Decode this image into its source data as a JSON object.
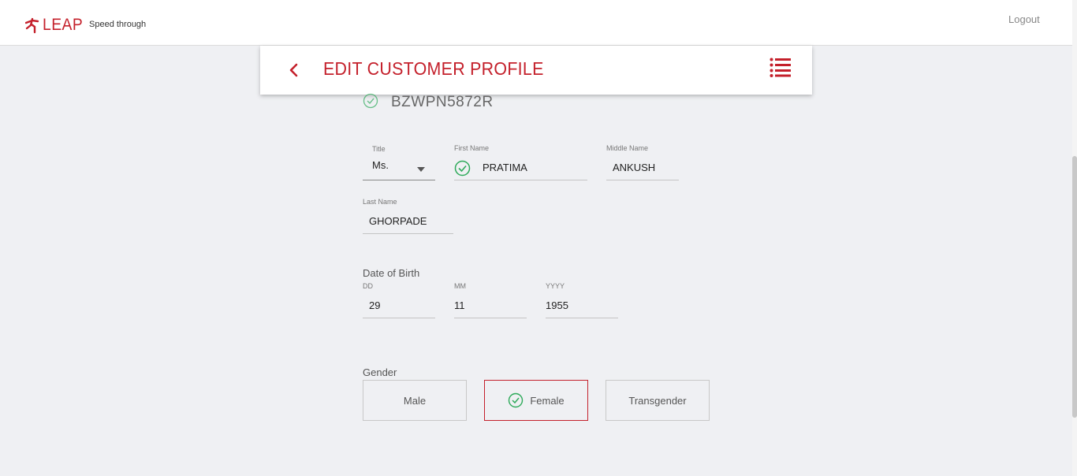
{
  "header": {
    "logo_text": "LEAP",
    "tagline": "Speed through",
    "logout_label": "Logout"
  },
  "page": {
    "title": "EDIT CUSTOMER PROFILE",
    "pan": "BZWPN5872R"
  },
  "name_fields": {
    "title": {
      "label": "Title",
      "value": "Ms."
    },
    "first_name": {
      "label": "First Name",
      "value": "PRATIMA"
    },
    "middle_name": {
      "label": "Middle Name",
      "value": "ANKUSH"
    },
    "last_name": {
      "label": "Last Name",
      "value": "GHORPADE"
    }
  },
  "dob": {
    "label": "Date of Birth",
    "day": {
      "label": "DD",
      "value": "29"
    },
    "month": {
      "label": "MM",
      "value": "11"
    },
    "year": {
      "label": "YYYY",
      "value": "1955"
    }
  },
  "gender": {
    "label": "Gender",
    "options": [
      "Male",
      "Female",
      "Transgender"
    ],
    "selected": "Female"
  },
  "colors": {
    "brand": "#c4202b",
    "success": "#2eaa5a",
    "background": "#eff0f3"
  },
  "icons": [
    "runner-logo-icon",
    "back-chevron-icon",
    "menu-list-icon",
    "check-circle-icon",
    "dropdown-arrow-icon"
  ]
}
